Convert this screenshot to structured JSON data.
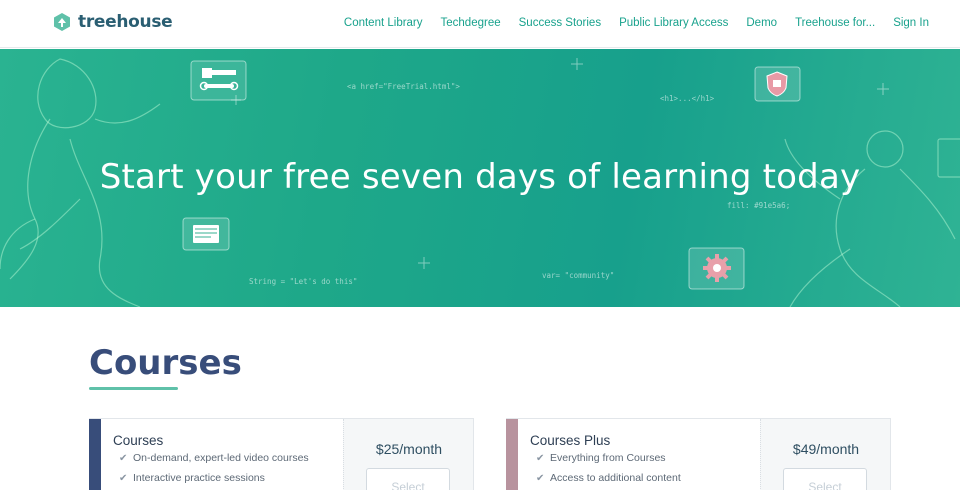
{
  "header": {
    "logo_text": "treehouse",
    "nav": [
      "Content Library",
      "Techdegree",
      "Success Stories",
      "Public Library Access",
      "Demo",
      "Treehouse for...",
      "Sign In"
    ]
  },
  "hero": {
    "title": "Start your free seven days of learning today",
    "code_snippets": {
      "a_href": "<a href=\"FreeTrial.html\">",
      "h1": "<h1>...</h1>",
      "fill": "fill: #91e5a6;",
      "string": "String = \"Let's do this\"",
      "var": "var= \"community\""
    },
    "icons": [
      "tools-icon",
      "shield-icon",
      "code-window-icon",
      "gear-icon"
    ]
  },
  "courses": {
    "heading": "Courses",
    "plans": [
      {
        "name": "Courses",
        "price": "$25/month",
        "features": [
          "On-demand, expert-led video courses",
          "Interactive practice sessions"
        ],
        "button": "Select",
        "accent": "#384d7a"
      },
      {
        "name": "Courses Plus",
        "price": "$49/month",
        "features": [
          "Everything from Courses",
          "Access to additional content"
        ],
        "button": "Select",
        "accent": "#b8939e"
      }
    ]
  },
  "colors": {
    "brand_green": "#19a28d",
    "hero_bg": "#1ea889",
    "title_navy": "#384d7a",
    "rule_green": "#5fc1a9"
  }
}
